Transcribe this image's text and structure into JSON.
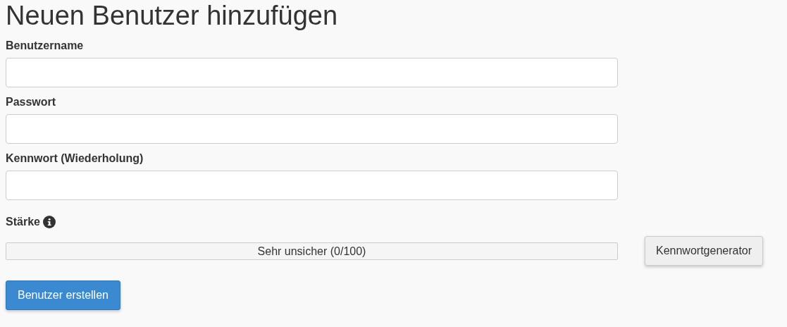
{
  "title": "Neuen Benutzer hinzufügen",
  "fields": [
    {
      "label": "Benutzername"
    },
    {
      "label": "Passwort"
    },
    {
      "label": "Kennwort (Wiederholung)"
    }
  ],
  "strength": {
    "label": "Stärke",
    "level": 0,
    "reading": "Sehr unsicher (0/100)"
  },
  "generator_button": "Kennwortgenerator",
  "submit_button": "Benutzer erstellen"
}
